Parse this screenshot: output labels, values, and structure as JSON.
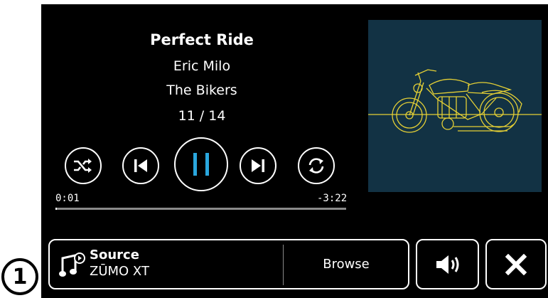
{
  "now_playing": {
    "title": "Perfect Ride",
    "artist": "Eric Milo",
    "album": "The Bikers",
    "track_position": "11 / 14",
    "elapsed": "0:01",
    "remaining": "-3:22",
    "progress_fraction": 0.005
  },
  "controls": {
    "shuffle_icon": "shuffle-icon",
    "previous_icon": "skip-previous-icon",
    "pause_icon": "pause-icon",
    "next_icon": "skip-next-icon",
    "repeat_icon": "repeat-icon"
  },
  "album_art": {
    "icon": "motorcycle-line-art",
    "background": "#123244",
    "line_color": "#e5d035"
  },
  "bottom_bar": {
    "source_label": "Source",
    "source_value": "ZŪMO XT",
    "browse_label": "Browse",
    "volume_icon": "speaker-volume-icon",
    "close_icon": "close-icon"
  },
  "callout": {
    "number": "1"
  },
  "colors": {
    "accent": "#2aa7de",
    "screen_bg": "#000000",
    "text": "#ffffff"
  }
}
